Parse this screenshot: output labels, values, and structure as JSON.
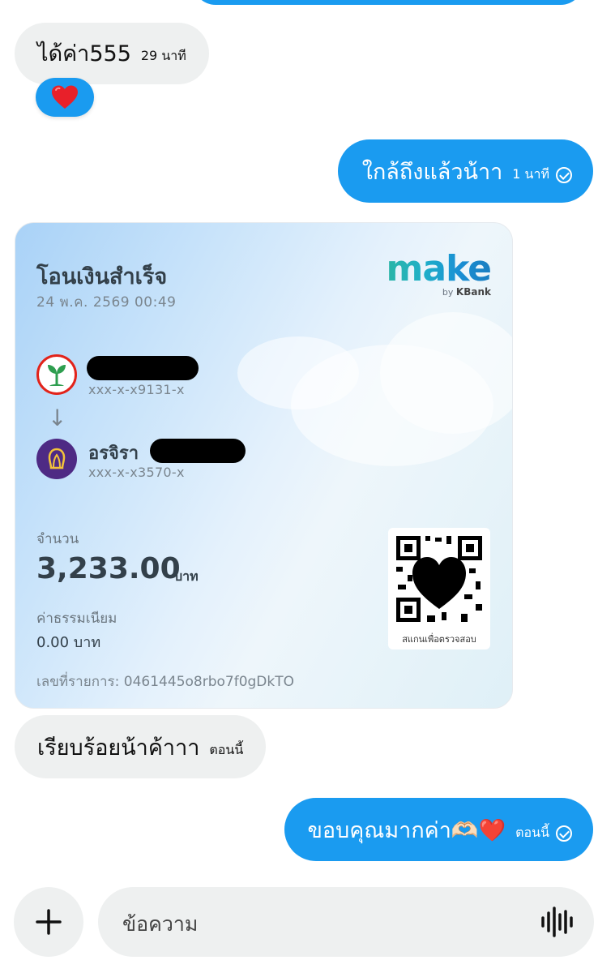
{
  "messages": [
    {
      "text": "ได้ค่า555",
      "time": "29 นาที"
    },
    {
      "reaction": "❤️"
    },
    {
      "text": "ใกล้ถึงแล้วน้าา",
      "time": "1 นาที"
    },
    {
      "text": "เรียบร้อยน้าค้าาา",
      "time": "ตอนนี้"
    },
    {
      "text": "ขอบคุณมากค่า🫶🏻❤️",
      "time": "ตอนนี้"
    }
  ],
  "receipt": {
    "title": "โอนเงินสำเร็จ",
    "date": "24 พ.ค. 2569 00:49",
    "logo_text": "make",
    "logo_by": "by",
    "logo_bank": "KBank",
    "from": {
      "account": "xxx-x-x9131-x"
    },
    "to": {
      "name": "อรจิรา",
      "account": "xxx-x-x3570-x"
    },
    "amount_label": "จำนวน",
    "amount": "3,233.00",
    "amount_unit": "บาท",
    "fee_label": "ค่าธรรมเนียม",
    "fee": "0.00 บาท",
    "txid": "เลขที่รายการ: 0461445o8rbo7f0gDkTO",
    "qr_caption": "สแกนเพื่อตรวจสอบ"
  },
  "composer": {
    "placeholder": "ข้อความ"
  },
  "colors": {
    "outgoing_bubble": "#1a9bf0",
    "incoming_bubble": "#eef0f0",
    "kbank_green": "#2e9e4f",
    "scb_purple": "#4e2a84"
  },
  "icons": [
    "heart-reaction-icon",
    "sent-check-icon",
    "kbank-logo-icon",
    "scb-logo-icon",
    "arrow-down-icon",
    "qr-code-icon",
    "plus-icon",
    "voice-wave-icon"
  ]
}
